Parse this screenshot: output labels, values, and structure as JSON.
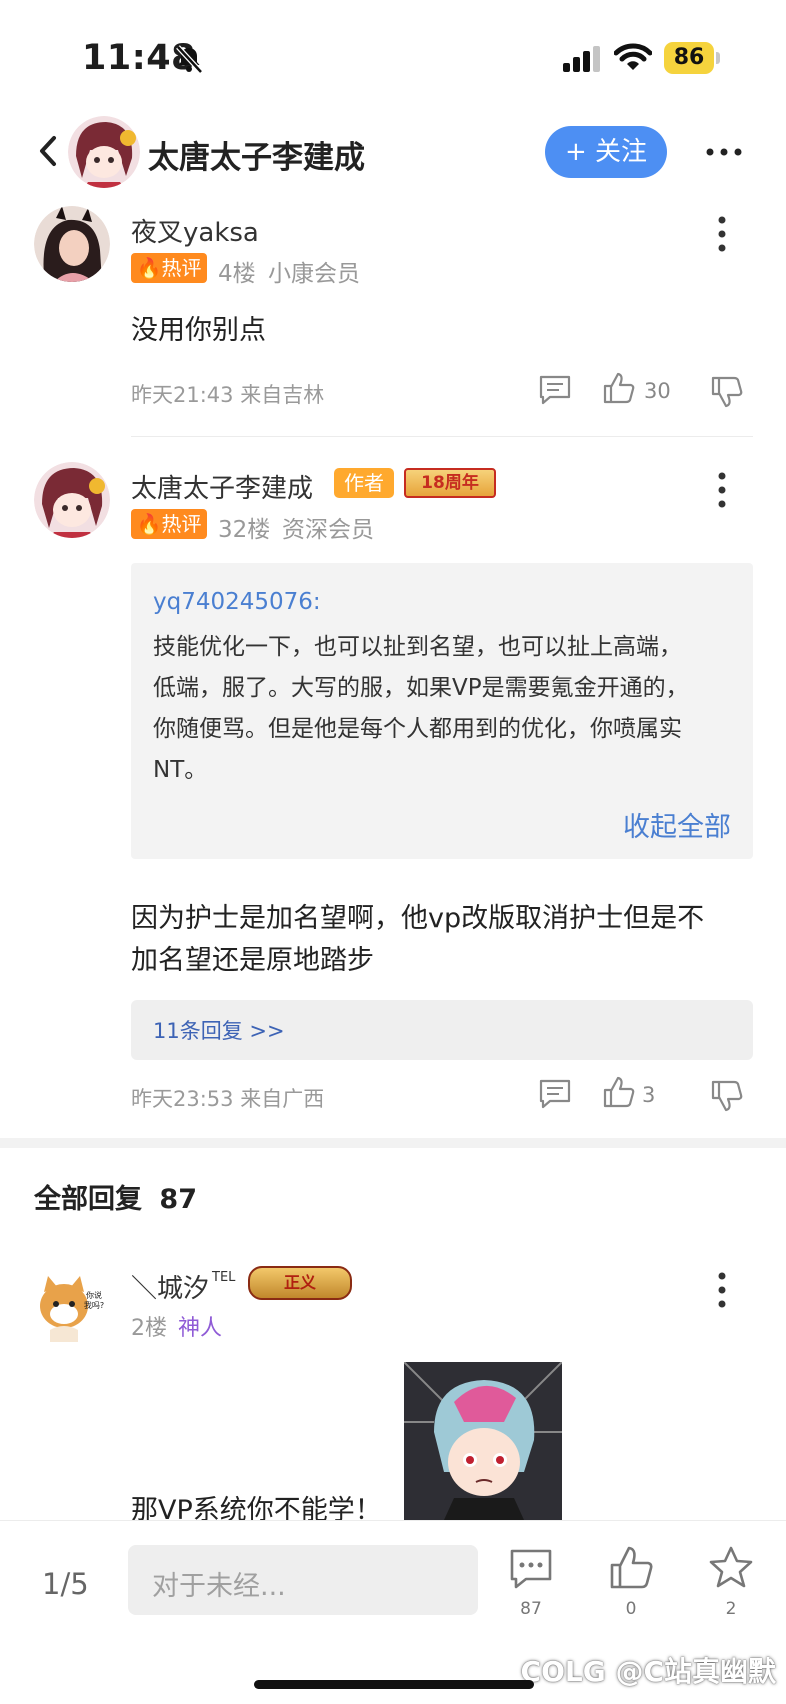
{
  "status_bar": {
    "time": "11:48",
    "battery": "86"
  },
  "header": {
    "title": "太唐太子李建成",
    "follow_label": "+ 关注"
  },
  "comments": [
    {
      "username": "夜叉yaksa",
      "hot_label": "热评",
      "floor": "4楼",
      "member_level": "小康会员",
      "text": "没用你别点",
      "time_location": "昨天21:43 来自吉林",
      "likes": "30"
    },
    {
      "username": "太唐太子李建成",
      "author_label": "作者",
      "anniversary_label": "18周年",
      "hot_label": "热评",
      "floor": "32楼",
      "member_level": "资深会员",
      "quote": {
        "user": "yq740245076:",
        "lines": [
          "技能优化一下，也可以扯到名望，也可以扯上高端，",
          "低端，服了。大写的服，如果VP是需要氪金开通的，",
          "你随便骂。但是他是每个人都用到的优化，你喷属实",
          "NT。"
        ],
        "collapse_label": "收起全部"
      },
      "text_lines": [
        "因为护士是加名望啊，他vp改版取消护士但是不",
        "加名望还是原地踏步"
      ],
      "replies_label": "11条回复 >>",
      "time_location": "昨天23:53 来自广西",
      "likes": "3"
    }
  ],
  "all_replies": {
    "title": "全部回复",
    "count": "87",
    "first": {
      "username": "＼城汐",
      "tel_tag": "TEL",
      "vip_label": "正义",
      "floor": "2楼",
      "level_name": "神人",
      "avatar_text": "你说\n我吗?",
      "text": "那VP系统你不能学！"
    }
  },
  "bottom_bar": {
    "page_indicator": "1/5",
    "input_placeholder": "对于未经...",
    "comment_count": "87",
    "like_count": "0",
    "star_count": "2",
    "watermark": "COLG @C站真幽默"
  },
  "colors": {
    "accent": "#4d8ff3",
    "hot": "#ff8a1e",
    "link": "#4a7fd1",
    "level_purple": "#8f5bd6"
  }
}
